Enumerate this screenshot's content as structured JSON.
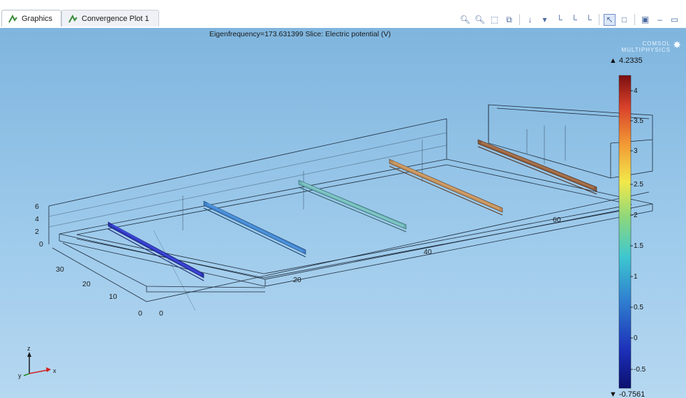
{
  "tabs": [
    {
      "label": "Graphics"
    },
    {
      "label": "Convergence Plot 1"
    }
  ],
  "toolbar": {
    "icons": [
      "zoom-in-icon",
      "zoom-out-icon",
      "zoom-box-icon",
      "zoom-extents-icon",
      "scene-light-icon",
      "xy-plane-icon",
      "yz-plane-icon",
      "zx-plane-icon",
      "select-mode-icon",
      "transparency-icon",
      "snapshot-icon",
      "minimize-icon",
      "maximize-icon"
    ]
  },
  "plot": {
    "title": "Eigenfrequency=173.631399   Slice: Electric potential (V)",
    "logo": {
      "line1": "COMSOL",
      "line2": "MULTIPHYSICS"
    }
  },
  "colorbar": {
    "max_label": "▲ 4.2335",
    "min_label": "▼ -0.7561",
    "ticks": [
      "4",
      "3.5",
      "3",
      "2.5",
      "2",
      "1.5",
      "1",
      "0.5",
      "0",
      "-0.5"
    ]
  },
  "axes": {
    "z_ticks": [
      "6",
      "4",
      "2",
      "0"
    ],
    "y_ticks": [
      "30",
      "20",
      "10",
      "0"
    ],
    "x_ticks": [
      "0",
      "20",
      "40",
      "60"
    ],
    "triad": {
      "z": "z",
      "y": "y",
      "x": "x"
    }
  },
  "colors": {
    "background_top": "#7fb5de",
    "background_bottom": "#b6d8f1",
    "wire": "#1c2a3a",
    "slice_colors": [
      "#2a31b0",
      "#3e7fc8",
      "#6ab0b4",
      "#b88a5a",
      "#8a5a3a"
    ]
  }
}
